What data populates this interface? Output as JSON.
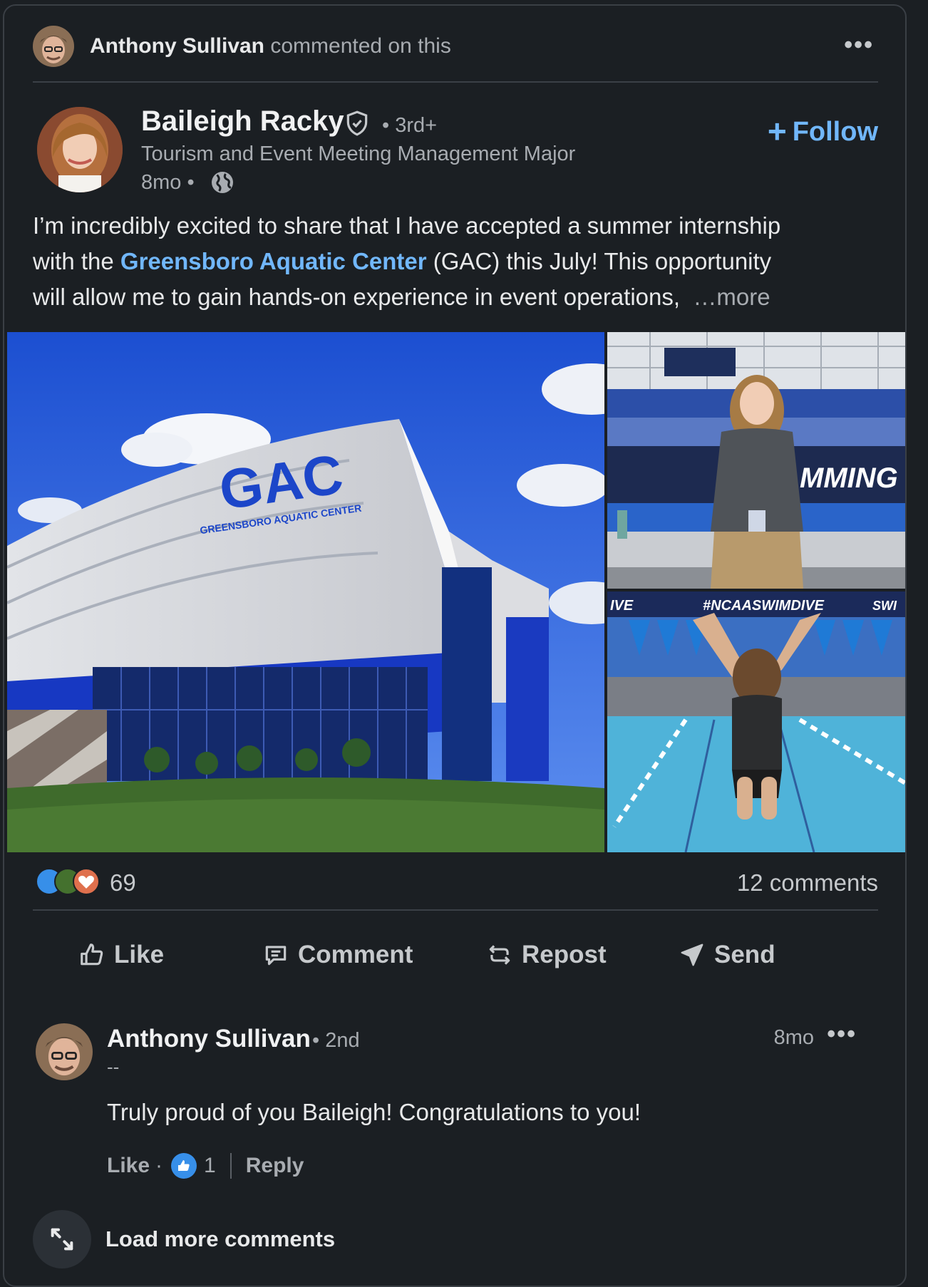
{
  "activity": {
    "actor": "Anthony Sullivan",
    "action": "commented on this"
  },
  "post": {
    "author": "Baileigh Racky",
    "degree": "• 3rd+",
    "headline": "Tourism and Event Meeting Management Major",
    "time": "8mo •",
    "follow_label": "Follow",
    "text_line1": "I’m incredibly excited to share that I have accepted a summer internship",
    "text_pre_link": "with the ",
    "text_link": "Greensboro Aquatic Center",
    "text_post_link": " (GAC) this July! This opportunity",
    "text_line3": "will allow me to gain hands-on experience in event operations,",
    "more_label": "…more",
    "images": {
      "building_sign": "GAC",
      "building_subsign": "GREENSBORO AQUATIC CENTER",
      "banner_text": "MMING &",
      "hashtag": "#NCAASWIMDIVE",
      "banner_left": "IVE",
      "banner_right": "SWI"
    }
  },
  "social": {
    "reaction_count": "69",
    "comment_count": "12 comments"
  },
  "actions": {
    "like": "Like",
    "comment": "Comment",
    "repost": "Repost",
    "send": "Send"
  },
  "comment": {
    "author": "Anthony Sullivan",
    "degree": "• 2nd",
    "subtitle": "--",
    "time": "8mo",
    "text": "Truly proud of you Baileigh! Congratulations to you!",
    "like_label": "Like",
    "sep": "·",
    "like_count": "1",
    "reply_label": "Reply"
  },
  "load_more": "Load more comments",
  "colors": {
    "background": "#1b1f23",
    "link": "#71b7fb",
    "like_blue": "#378fe9",
    "celebrate_green": "#44712e",
    "love_red": "#df704d"
  }
}
